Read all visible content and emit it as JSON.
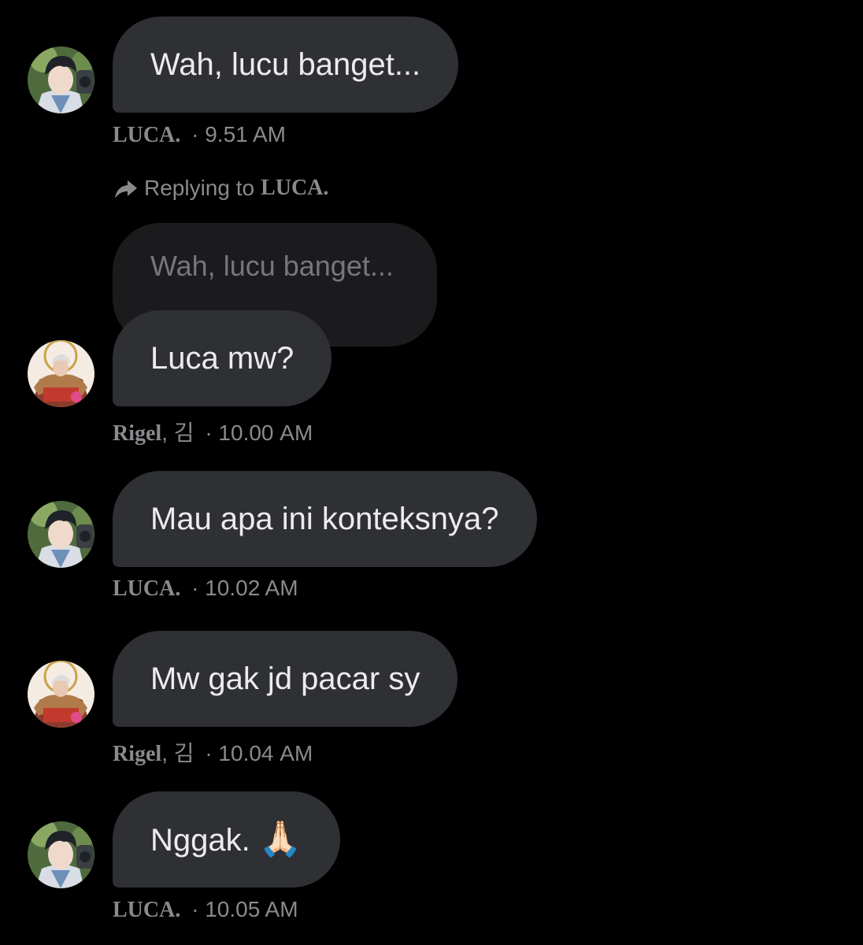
{
  "messages": [
    {
      "sender": "LUCA.",
      "text": "Wah, lucu banget...",
      "time": "· 9.51 AM",
      "avatar": "luca-avatar"
    },
    {
      "sender": "Rigel",
      "sender_suffix": ", 김",
      "text": "Luca mw?",
      "time": "· 10.00 AM",
      "avatar": "rigel-avatar",
      "reply": {
        "prefix": "Replying to",
        "to": "LUCA.",
        "quoted_text": "Wah, lucu banget...",
        "icon": "reply-arrow-icon"
      }
    },
    {
      "sender": "LUCA.",
      "text": "Mau apa ini konteksnya?",
      "time": "· 10.02 AM",
      "avatar": "luca-avatar"
    },
    {
      "sender": "Rigel",
      "sender_suffix": ", 김",
      "text": "Mw gak jd pacar sy",
      "time": "· 10.04 AM",
      "avatar": "rigel-avatar"
    },
    {
      "sender": "LUCA.",
      "text": "Nggak.",
      "emoji": "🙏🏻",
      "time": "· 10.05 AM",
      "avatar": "luca-avatar"
    }
  ],
  "colors": {
    "background": "#000000",
    "bubble": "#2f3033",
    "quoted_bubble": "#1b1b1d",
    "meta_text": "#8a8a8e",
    "message_text": "#ececee"
  }
}
